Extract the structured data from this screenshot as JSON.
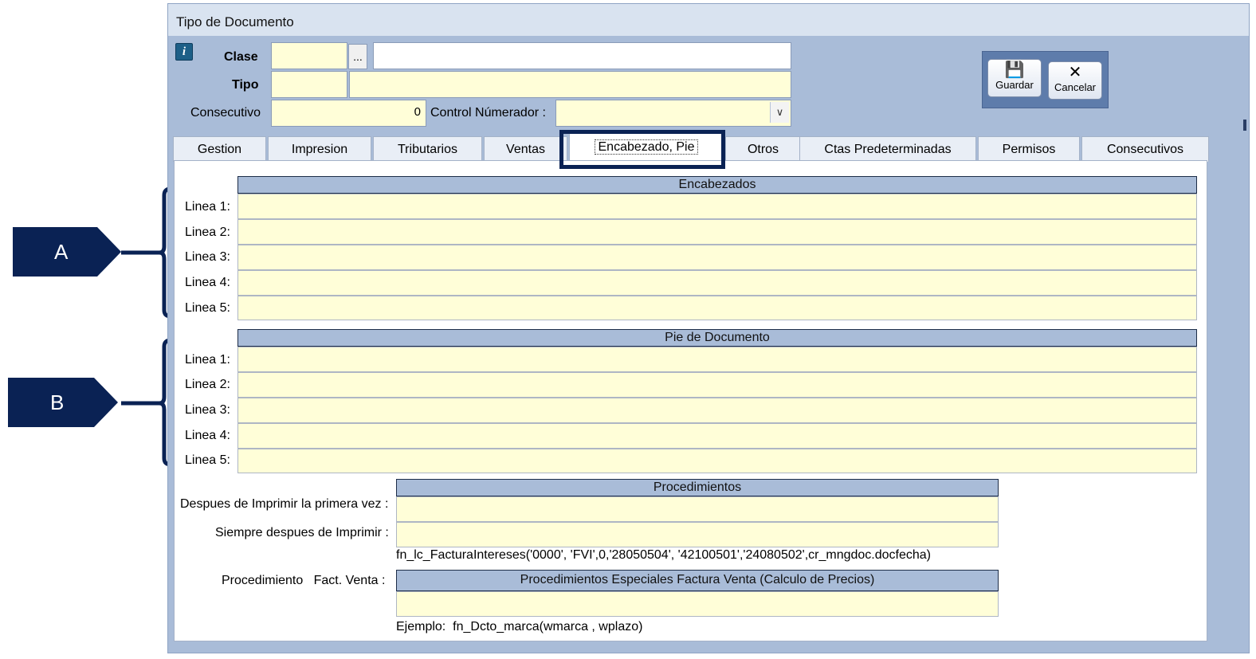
{
  "window": {
    "title": "Tipo de Documento"
  },
  "form": {
    "clase_label": "Clase",
    "clase_code": "",
    "clase_desc": "",
    "ellipsis": "...",
    "tipo_label": "Tipo",
    "tipo_code": "",
    "tipo_desc": "",
    "consecutivo_label": "Consecutivo",
    "consecutivo_value": "0",
    "control_label": "Control Númerador :",
    "control_value": "",
    "combo_arrow": "∨"
  },
  "toolbar": {
    "save_label": "Guardar",
    "cancel_label": "Cancelar"
  },
  "tabs": [
    {
      "label": "Gestion"
    },
    {
      "label": "Impresion"
    },
    {
      "label": "Tributarios"
    },
    {
      "label": "Ventas"
    },
    {
      "label": "Encabezado, Pie",
      "active": true
    },
    {
      "label": "Otros"
    },
    {
      "label": "Ctas Predeterminadas"
    },
    {
      "label": "Permisos"
    },
    {
      "label": "Consecutivos"
    }
  ],
  "encabezados": {
    "header": "Encabezados",
    "lines": [
      "Linea 1:",
      "Linea 2:",
      "Linea 3:",
      "Linea 4:",
      "Linea 5:"
    ]
  },
  "pie": {
    "header": "Pie de Documento",
    "lines": [
      "Linea 1:",
      "Linea 2:",
      "Linea 3:",
      "Linea 4:",
      "Linea 5:"
    ]
  },
  "procedimientos": {
    "header": "Procedimientos",
    "first_print_label": "Despues de Imprimir la primera vez :",
    "always_label": "Siempre despues de Imprimir :",
    "example_text": "fn_lc_FacturaIntereses('0000', 'FVI',0,'28050504', '42100501','24080502',cr_mngdoc.docfecha)"
  },
  "especiales": {
    "label": "Procedimiento   Fact. Venta :",
    "header": "Procedimientos Especiales Factura Venta  (Calculo de Precios)",
    "example_text": "Ejemplo:  fn_Dcto_marca(wmarca , wplazo)"
  },
  "annotations": {
    "a": "A",
    "b": "B"
  },
  "colors": {
    "navy": "#0a2254",
    "field_bg": "#fffed8",
    "frame": "#a9bcd8"
  }
}
